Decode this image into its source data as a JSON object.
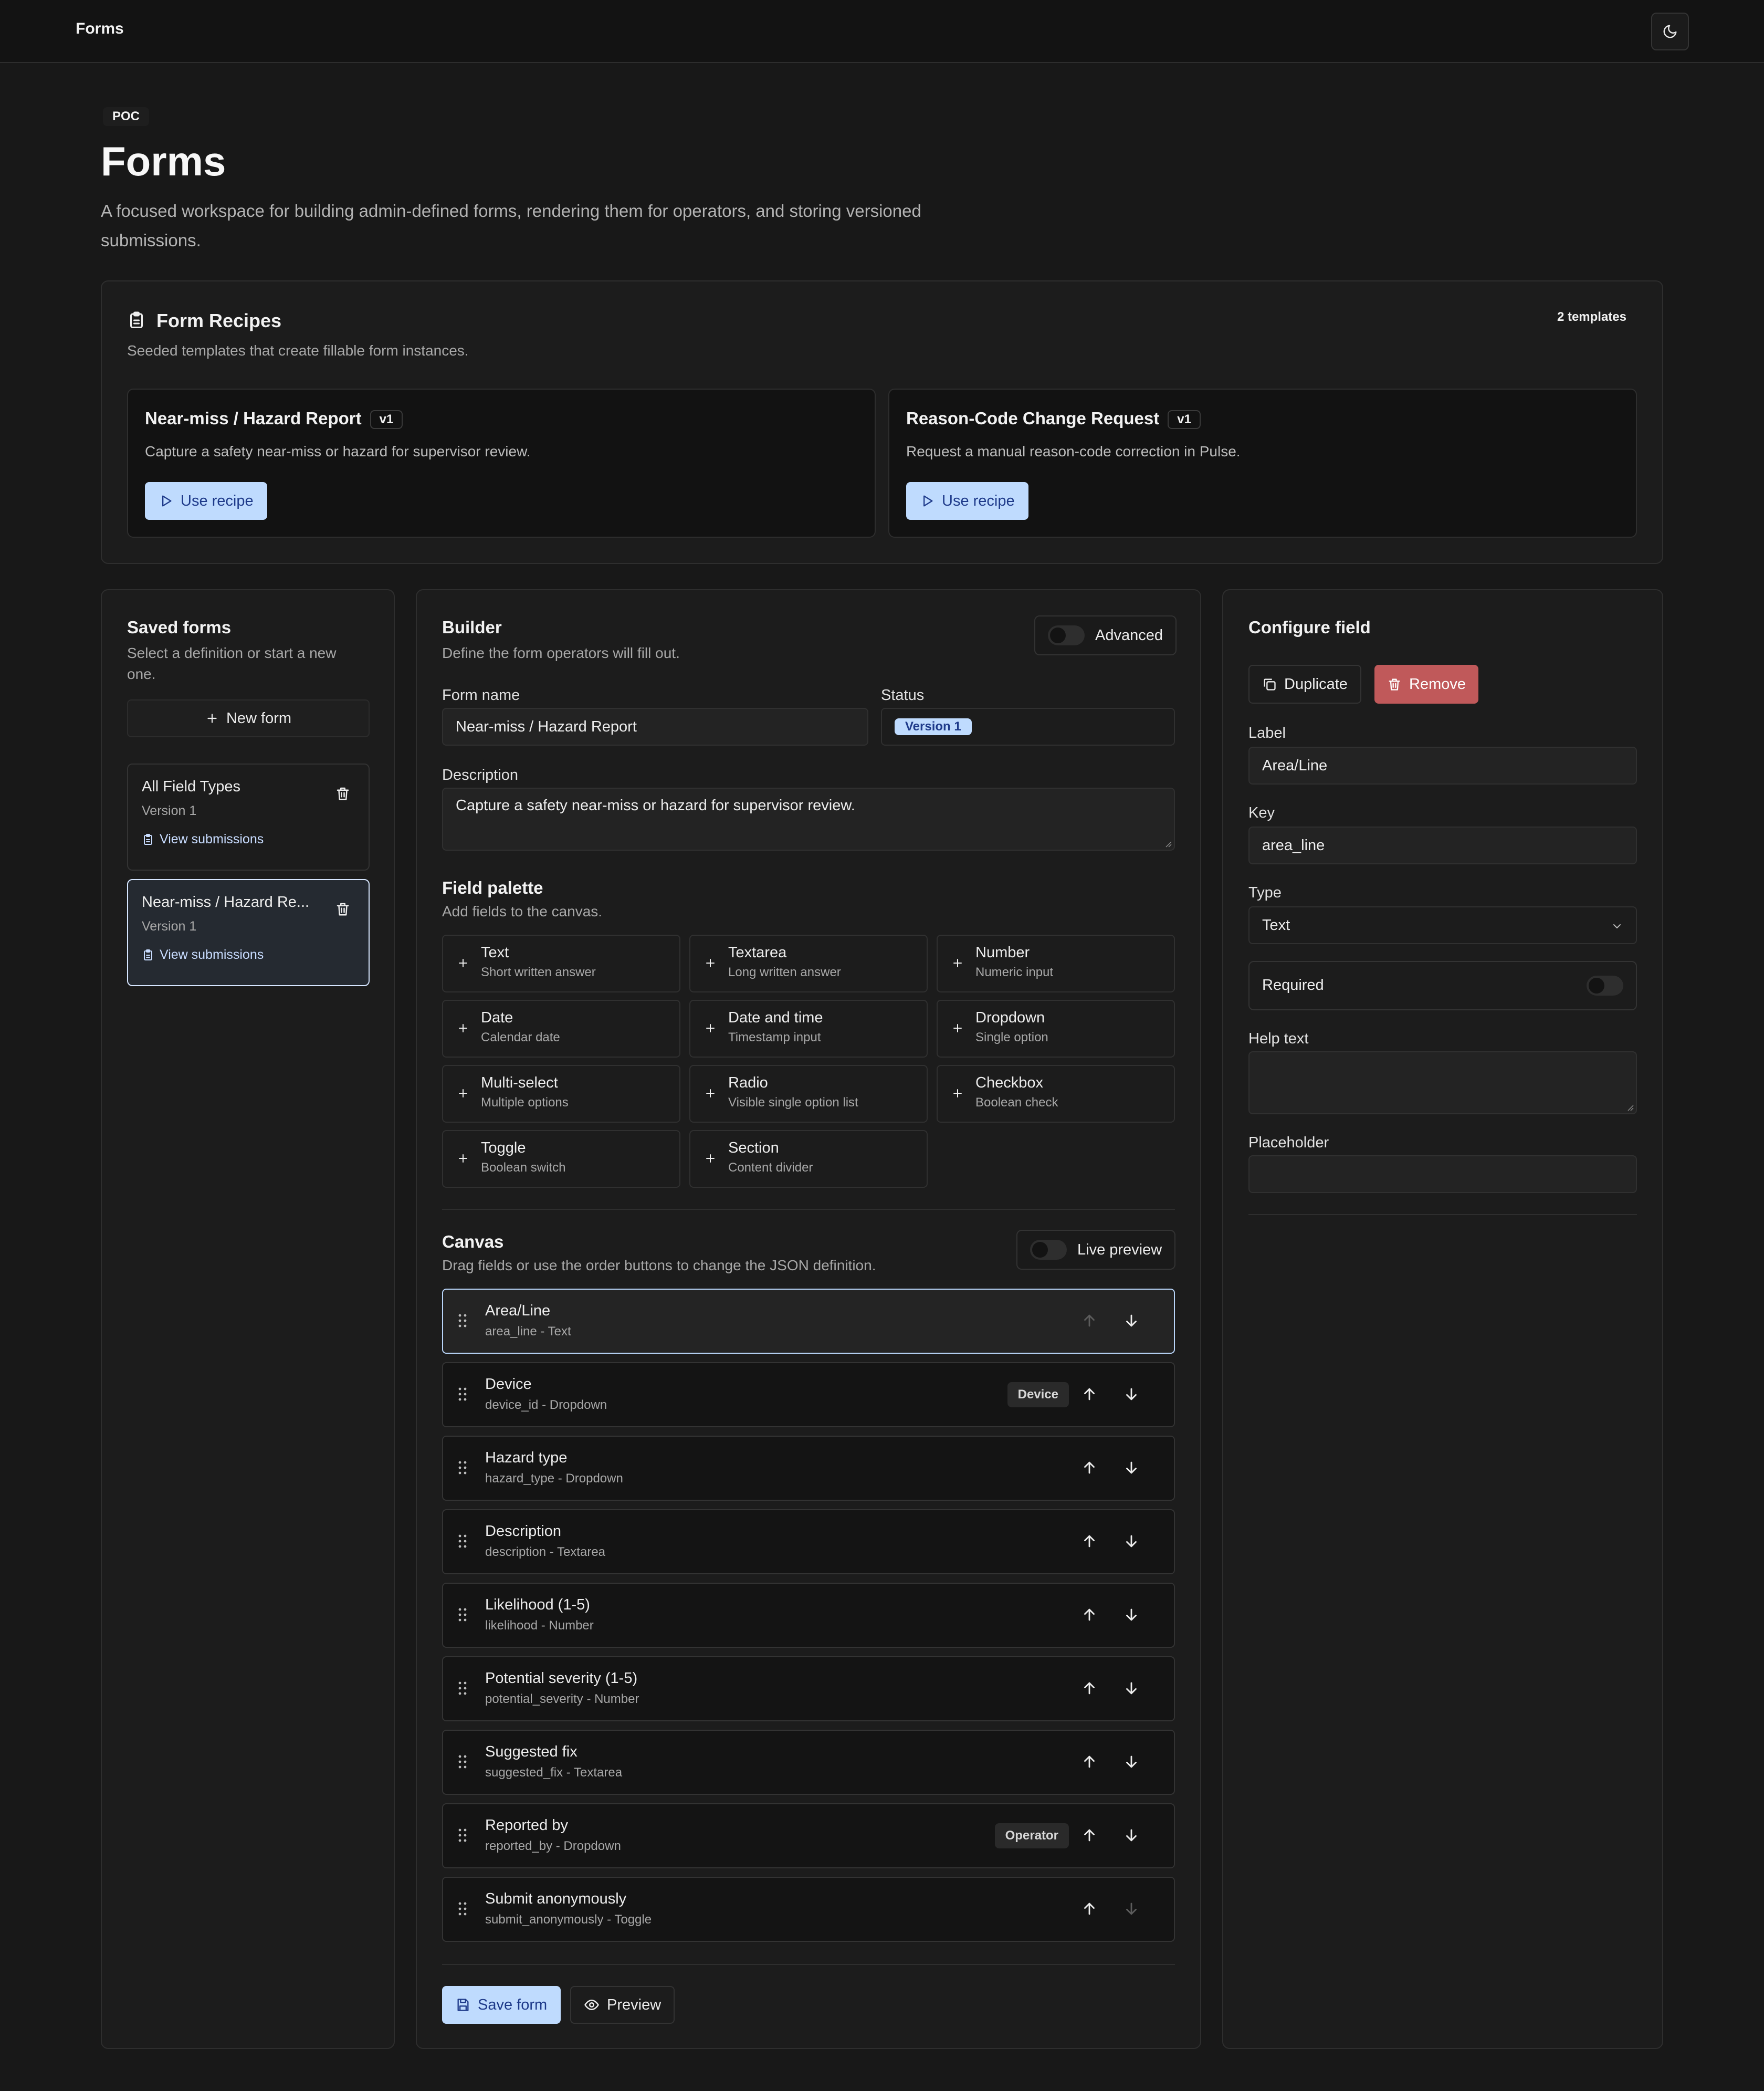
{
  "topbar": {
    "title": "Forms",
    "theme_icon": "moon-icon"
  },
  "header": {
    "badge": "POC",
    "title": "Forms",
    "description": "A focused workspace for building admin-defined forms, rendering them for operators, and storing versioned submissions."
  },
  "recipes": {
    "title": "Form Recipes",
    "subtitle": "Seeded templates that create fillable form instances.",
    "count": "2 templates",
    "items": [
      {
        "name": "Near-miss / Hazard Report",
        "version": "v1",
        "description": "Capture a safety near-miss or hazard for supervisor review.",
        "button": "Use recipe"
      },
      {
        "name": "Reason-Code Change Request",
        "version": "v1",
        "description": "Request a manual reason-code correction in Pulse.",
        "button": "Use recipe"
      }
    ]
  },
  "saved": {
    "title": "Saved forms",
    "subtitle": "Select a definition or start a new one.",
    "new_button": "New form",
    "items": [
      {
        "name": "All Field Types",
        "version": "Version 1",
        "link": "View submissions"
      },
      {
        "name": "Near-miss / Hazard Re...",
        "version": "Version 1",
        "link": "View submissions"
      }
    ]
  },
  "builder": {
    "title": "Builder",
    "subtitle": "Define the form operators will fill out.",
    "advanced_label": "Advanced",
    "form_name_label": "Form name",
    "form_name_value": "Near-miss / Hazard Report",
    "status_label": "Status",
    "status_value": "Version 1",
    "description_label": "Description",
    "description_value": "Capture a safety near-miss or hazard for supervisor review.",
    "palette_title": "Field palette",
    "palette_subtitle": "Add fields to the canvas.",
    "palette": [
      {
        "title": "Text",
        "sub": "Short written answer"
      },
      {
        "title": "Textarea",
        "sub": "Long written answer"
      },
      {
        "title": "Number",
        "sub": "Numeric input"
      },
      {
        "title": "Date",
        "sub": "Calendar date"
      },
      {
        "title": "Date and time",
        "sub": "Timestamp input"
      },
      {
        "title": "Dropdown",
        "sub": "Single option"
      },
      {
        "title": "Multi-select",
        "sub": "Multiple options"
      },
      {
        "title": "Radio",
        "sub": "Visible single option list"
      },
      {
        "title": "Checkbox",
        "sub": "Boolean check"
      },
      {
        "title": "Toggle",
        "sub": "Boolean switch"
      },
      {
        "title": "Section",
        "sub": "Content divider"
      }
    ],
    "canvas_title": "Canvas",
    "canvas_subtitle": "Drag fields or use the order buttons to change the JSON definition.",
    "live_preview_label": "Live preview",
    "fields": [
      {
        "label": "Area/Line",
        "meta": "area_line - Text",
        "tag": ""
      },
      {
        "label": "Device",
        "meta": "device_id - Dropdown",
        "tag": "Device"
      },
      {
        "label": "Hazard type",
        "meta": "hazard_type - Dropdown",
        "tag": ""
      },
      {
        "label": "Description",
        "meta": "description - Textarea",
        "tag": ""
      },
      {
        "label": "Likelihood (1-5)",
        "meta": "likelihood - Number",
        "tag": ""
      },
      {
        "label": "Potential severity (1-5)",
        "meta": "potential_severity - Number",
        "tag": ""
      },
      {
        "label": "Suggested fix",
        "meta": "suggested_fix - Textarea",
        "tag": ""
      },
      {
        "label": "Reported by",
        "meta": "reported_by - Dropdown",
        "tag": "Operator"
      },
      {
        "label": "Submit anonymously",
        "meta": "submit_anonymously - Toggle",
        "tag": ""
      }
    ],
    "save_button": "Save form",
    "preview_button": "Preview"
  },
  "config": {
    "title": "Configure field",
    "duplicate_button": "Duplicate",
    "remove_button": "Remove",
    "label_label": "Label",
    "label_value": "Area/Line",
    "key_label": "Key",
    "key_value": "area_line",
    "type_label": "Type",
    "type_value": "Text",
    "required_label": "Required",
    "help_label": "Help text",
    "help_value": "",
    "placeholder_label": "Placeholder",
    "placeholder_value": ""
  },
  "colors": {
    "accent": "#bfdbfe",
    "danger": "#c0595a",
    "background": "#181818",
    "panel": "#1c1c1c"
  }
}
